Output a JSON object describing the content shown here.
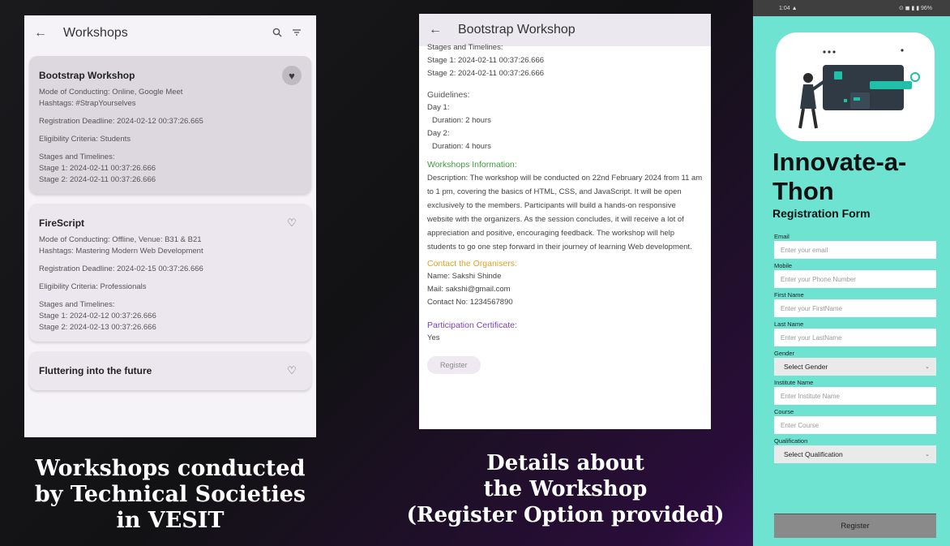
{
  "screen1": {
    "title": "Workshops",
    "back_icon": "arrow-left-icon",
    "search_icon": "search-icon",
    "filter_icon": "filter-icon",
    "cards": [
      {
        "title": "Bootstrap Workshop",
        "favorited": true,
        "lines_a": [
          "Mode of Conducting: Online, Google Meet",
          "Hashtags: #StrapYourselves"
        ],
        "lines_b": [
          "Registration Deadline: 2024-02-12 00:37:26.665"
        ],
        "lines_c": [
          "Eligibility Criteria: Students"
        ],
        "lines_d": [
          "Stages and Timelines:",
          "Stage 1: 2024-02-11 00:37:26.666",
          "Stage 2: 2024-02-11 00:37:26.666"
        ]
      },
      {
        "title": "FireScript",
        "favorited": false,
        "lines_a": [
          "Mode of Conducting: Offline, Venue: B31 & B21",
          "Hashtags: Mastering Modern Web Development"
        ],
        "lines_b": [
          "Registration Deadline: 2024-02-15 00:37:26.666"
        ],
        "lines_c": [
          "Eligibility Criteria: Professionals"
        ],
        "lines_d": [
          "Stages and Timelines:",
          "Stage 1: 2024-02-12 00:37:26.666",
          "Stage 2: 2024-02-13 00:37:26.666"
        ]
      },
      {
        "title": "Fluttering into the future",
        "favorited": false
      }
    ]
  },
  "screen2": {
    "title": "Bootstrap Workshop",
    "stages_heading": "Stages and Timelines:",
    "stage1": "Stage 1: 2024-02-11 00:37:26.666",
    "stage2": "Stage 2: 2024-02-11 00:37:26.666",
    "guidelines_heading": "Guidelines:",
    "day1": "Day 1:",
    "duration1": "Duration: 2 hours",
    "day2": "Day 2:",
    "duration2": "Duration: 4 hours",
    "info_heading": "Workshops Information:",
    "description": "Description: The workshop will be conducted on 22nd February 2024 from 11 am to 1 pm, covering the basics of HTML, CSS, and JavaScript. It will be open exclusively to the members. Participants will build a hands-on responsive website with the organizers. As the session concludes, it will receive a lot of appreciation and positive, encouraging feedback. The workshop will help students to go one step forward in their journey of learning Web development.",
    "contact_heading": "Contact the Organisers:",
    "contact_name": "Name: Sakshi Shinde",
    "contact_mail": "Mail: sakshi@gmail.com",
    "contact_no": "Contact No: 1234567890",
    "cert_heading": "Participation Certificate:",
    "cert_value": "Yes",
    "register_label": "Register"
  },
  "screen3": {
    "status_left": "1:04 ▲",
    "status_right": "⊙ ◼ ▮ ▮ 96%",
    "title": "Innovate-a-Thon",
    "form_title": "Registration Form",
    "fields": [
      {
        "label": "Email",
        "placeholder": "Enter your email",
        "type": "input"
      },
      {
        "label": "Mobile",
        "placeholder": "Enter your Phone Number",
        "type": "input"
      },
      {
        "label": "First Name",
        "placeholder": "Enter your FirstName",
        "type": "input"
      },
      {
        "label": "Last Name",
        "placeholder": "Enter your LastName",
        "type": "input"
      },
      {
        "label": "Gender",
        "placeholder": "Select Gender",
        "type": "select"
      },
      {
        "label": "Institute Name",
        "placeholder": "Enter Institute Name",
        "type": "input"
      },
      {
        "label": "Course",
        "placeholder": "Enter Course",
        "type": "input"
      },
      {
        "label": "Qualification",
        "placeholder": "Select Qualification",
        "type": "select"
      }
    ],
    "register_label": "Register"
  },
  "captions": {
    "left": [
      "Workshops conducted",
      "by Technical Societies",
      "in VESIT"
    ],
    "middle": [
      "Details about",
      "the Workshop",
      "(Register Option provided)"
    ]
  },
  "colors": {
    "accent_green": "#3f9a3f",
    "accent_orange": "#e8a020",
    "accent_purple": "#7a3fb4",
    "form_background": "#6fe3d2"
  }
}
